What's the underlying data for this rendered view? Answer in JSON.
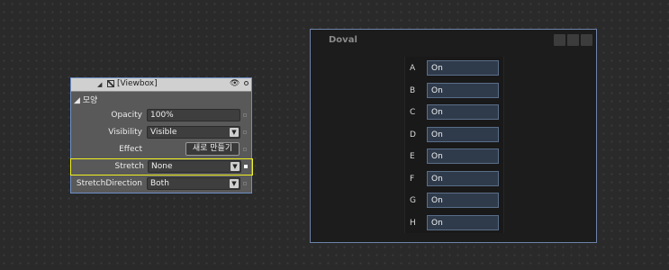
{
  "panel": {
    "title": "[Viewbox]",
    "section": "◢ 모양",
    "rows": {
      "opacity": {
        "label": "Opacity",
        "value": "100%"
      },
      "visibility": {
        "label": "Visibility",
        "value": "Visible"
      },
      "effect": {
        "label": "Effect",
        "button": "새로 만들기"
      },
      "stretch": {
        "label": "Stretch",
        "value": "None"
      },
      "stretch_direction": {
        "label": "StretchDirection",
        "value": "Both"
      }
    },
    "highlight_color": "#f0f020",
    "icons": [
      "collapse-arrow-icon",
      "viewbox-icon",
      "eye-icon",
      "pin-circle-icon",
      "dropdown-arrow-icon"
    ]
  },
  "window": {
    "title": "Doval",
    "items": [
      {
        "key": "A",
        "value": "On"
      },
      {
        "key": "B",
        "value": "On"
      },
      {
        "key": "C",
        "value": "On"
      },
      {
        "key": "D",
        "value": "On"
      },
      {
        "key": "E",
        "value": "On"
      },
      {
        "key": "F",
        "value": "On"
      },
      {
        "key": "G",
        "value": "On"
      },
      {
        "key": "H",
        "value": "On"
      }
    ]
  }
}
